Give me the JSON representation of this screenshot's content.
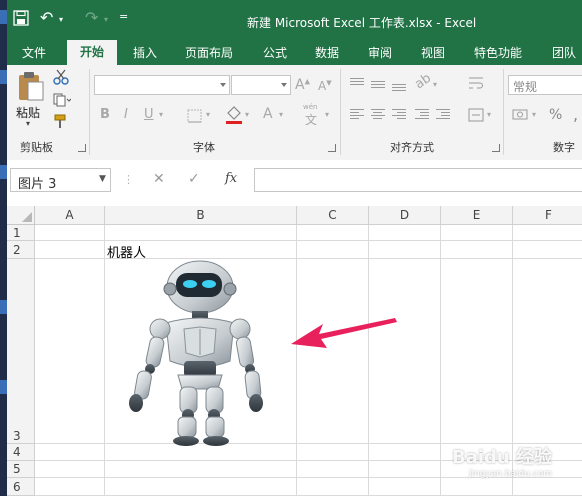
{
  "window": {
    "title": "新建 Microsoft Excel 工作表.xlsx - Excel"
  },
  "qat": {
    "undo_glyph": "↶",
    "redo_glyph": "↷",
    "customize_glyph": "=",
    "save_icon": "save-icon"
  },
  "tabs": [
    {
      "label": "文件"
    },
    {
      "label": "开始"
    },
    {
      "label": "插入"
    },
    {
      "label": "页面布局"
    },
    {
      "label": "公式"
    },
    {
      "label": "数据"
    },
    {
      "label": "审阅"
    },
    {
      "label": "视图"
    },
    {
      "label": "特色功能"
    },
    {
      "label": "团队"
    }
  ],
  "active_tab": "开始",
  "ribbon": {
    "clipboard": {
      "group_label": "剪贴板",
      "paste_label": "粘贴"
    },
    "font": {
      "group_label": "字体",
      "bold": "B",
      "italic": "I",
      "underline": "U",
      "font_color_glyph": "A",
      "wen_glyph": "wén"
    },
    "alignment": {
      "group_label": "对齐方式"
    },
    "number": {
      "group_label": "数字",
      "format": "常规",
      "percent": "%",
      "comma": ","
    }
  },
  "formula_bar": {
    "name_box": "图片 3",
    "cancel": "✕",
    "enter": "✓",
    "fx": "fx",
    "content": ""
  },
  "sheet": {
    "columns": [
      "A",
      "B",
      "C",
      "D",
      "E",
      "F"
    ],
    "rows": [
      "1",
      "2",
      "3",
      "4",
      "5",
      "6"
    ],
    "cells": {
      "B2": "机器人"
    },
    "picture_name": "robot-picture"
  },
  "colors": {
    "excel_green": "#217346",
    "arrow": "#e8215c",
    "ribbon_bg": "#f3f3f3"
  },
  "watermark": {
    "brand": "Baidu 经验",
    "url": "jingyan.baidu.com"
  }
}
